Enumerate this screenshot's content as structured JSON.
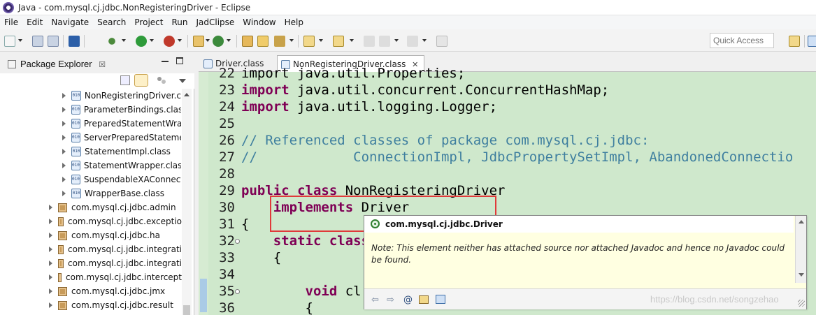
{
  "window": {
    "title": "Java - com.mysql.cj.jdbc.NonRegisteringDriver - Eclipse"
  },
  "menu": [
    "File",
    "Edit",
    "Navigate",
    "Search",
    "Project",
    "Run",
    "JadClipse",
    "Window",
    "Help"
  ],
  "toolbar": {
    "quick_access_placeholder": "Quick Access"
  },
  "explorer": {
    "tab_label": "Package Explorer",
    "tab_close": "☒",
    "items": [
      {
        "label": "NonRegisteringDriver.c",
        "kind": "class",
        "selected": true
      },
      {
        "label": "ParameterBindings.clas",
        "kind": "class"
      },
      {
        "label": "PreparedStatementWra",
        "kind": "class"
      },
      {
        "label": "ServerPreparedStateme",
        "kind": "class"
      },
      {
        "label": "StatementImpl.class",
        "kind": "class"
      },
      {
        "label": "StatementWrapper.clas",
        "kind": "class"
      },
      {
        "label": "SuspendableXAConnect",
        "kind": "class"
      },
      {
        "label": "WrapperBase.class",
        "kind": "class"
      },
      {
        "label": "com.mysql.cj.jdbc.admin",
        "kind": "package"
      },
      {
        "label": "com.mysql.cj.jdbc.exceptio",
        "kind": "package"
      },
      {
        "label": "com.mysql.cj.jdbc.ha",
        "kind": "package"
      },
      {
        "label": "com.mysql.cj.jdbc.integrati",
        "kind": "package"
      },
      {
        "label": "com.mysql.cj.jdbc.integrati",
        "kind": "package"
      },
      {
        "label": "com.mysql.cj.jdbc.intercept",
        "kind": "package"
      },
      {
        "label": "com.mysql.cj.jdbc.jmx",
        "kind": "package"
      },
      {
        "label": "com.mysql.cj.jdbc.result",
        "kind": "package"
      }
    ],
    "class_icon_text": "010"
  },
  "editor": {
    "tabs": [
      {
        "label": "Driver.class",
        "active": false
      },
      {
        "label": "NonRegisteringDriver.class",
        "active": true,
        "close": "✕"
      }
    ],
    "lines": [
      {
        "num": "22",
        "parts": [
          {
            "t": "import java.util.Properties;",
            "c": ""
          }
        ]
      },
      {
        "num": "23",
        "parts": [
          {
            "t": "import",
            "c": "kw"
          },
          {
            "t": " java.util.concurrent.ConcurrentHashMap;",
            "c": ""
          }
        ]
      },
      {
        "num": "24",
        "parts": [
          {
            "t": "import",
            "c": "kw"
          },
          {
            "t": " java.util.logging.Logger;",
            "c": ""
          }
        ]
      },
      {
        "num": "25",
        "parts": []
      },
      {
        "num": "26",
        "parts": [
          {
            "t": "// Referenced classes of package com.mysql.cj.jdbc:",
            "c": "cm"
          }
        ]
      },
      {
        "num": "27",
        "parts": [
          {
            "t": "//            ConnectionImpl, JdbcPropertySetImpl, AbandonedConnectio",
            "c": "cm"
          }
        ]
      },
      {
        "num": "28",
        "parts": []
      },
      {
        "num": "29",
        "parts": [
          {
            "t": "public class",
            "c": "kw"
          },
          {
            "t": " NonRegisteringDriver",
            "c": ""
          }
        ]
      },
      {
        "num": "30",
        "parts": [
          {
            "t": "    ",
            "c": ""
          },
          {
            "t": "implements",
            "c": "kw"
          },
          {
            "t": " Driver",
            "c": ""
          }
        ]
      },
      {
        "num": "31",
        "parts": [
          {
            "t": "{",
            "c": ""
          }
        ]
      },
      {
        "num": "32",
        "parts": [
          {
            "t": "    ",
            "c": ""
          },
          {
            "t": "static class",
            "c": "kw"
          },
          {
            "t": "                                                e",
            "c": ""
          }
        ]
      },
      {
        "num": "33",
        "parts": [
          {
            "t": "    {",
            "c": ""
          }
        ]
      },
      {
        "num": "34",
        "parts": []
      },
      {
        "num": "35",
        "parts": [
          {
            "t": "        ",
            "c": ""
          },
          {
            "t": "void",
            "c": "kw"
          },
          {
            "t": " cl",
            "c": ""
          }
        ]
      },
      {
        "num": "36",
        "parts": [
          {
            "t": "        {",
            "c": ""
          }
        ]
      }
    ]
  },
  "hover": {
    "title": "com.mysql.cj.jdbc.Driver",
    "note": "Note: This element neither has attached source nor attached Javadoc and hence no Javadoc could be found.",
    "toolbar": {
      "back": "⇦",
      "forward": "⇨",
      "at": "@"
    }
  },
  "watermark": "https://blog.csdn.net/songzehao"
}
